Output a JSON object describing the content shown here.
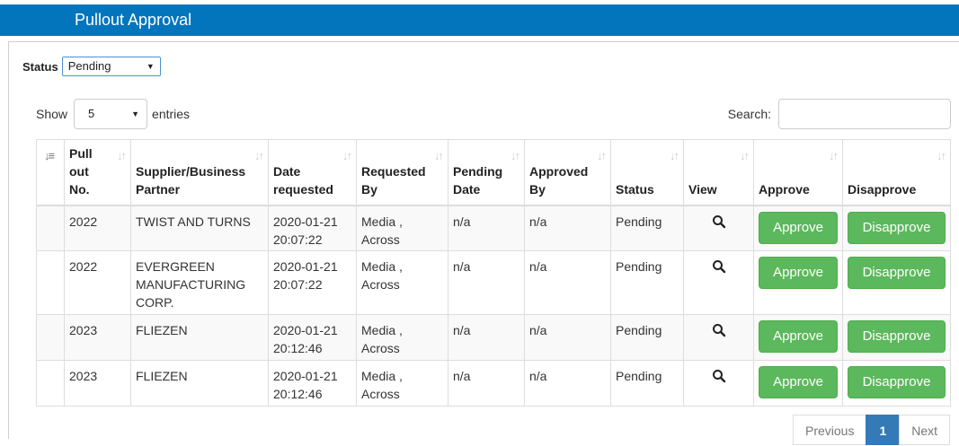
{
  "page": {
    "title": "Pullout Approval"
  },
  "filter": {
    "status_label": "Status",
    "status_value": "Pending"
  },
  "length_control": {
    "show_label": "Show",
    "value": "5",
    "entries_label": "entries"
  },
  "search": {
    "label": "Search:",
    "value": ""
  },
  "table": {
    "columns": [
      "Pull out No.",
      "Supplier/Business Partner",
      "Date requested",
      "Requested By",
      "Pending Date",
      "Approved By",
      "Status",
      "View",
      "Approve",
      "Disapprove"
    ],
    "header_lines": {
      "pullout": [
        "Pull",
        "out",
        "No."
      ],
      "supplier": [
        "Supplier/Business",
        "Partner"
      ],
      "date": [
        "Date",
        "requested"
      ],
      "requested": [
        "Requested",
        "By"
      ],
      "pending": [
        "Pending",
        "Date"
      ],
      "approved": [
        "Approved",
        "By"
      ]
    },
    "rows": [
      {
        "pullout_no": "2022",
        "supplier": [
          "TWIST AND TURNS"
        ],
        "date_requested": [
          "2020-01-21",
          "20:07:22"
        ],
        "requested_by": [
          "Media ,",
          "Across"
        ],
        "pending_date": "n/a",
        "approved_by": "n/a",
        "status": "Pending",
        "approve_label": "Approve",
        "disapprove_label": "Disapprove"
      },
      {
        "pullout_no": "2022",
        "supplier": [
          "EVERGREEN",
          "MANUFACTURING",
          "CORP."
        ],
        "date_requested": [
          "2020-01-21",
          "20:07:22"
        ],
        "requested_by": [
          "Media ,",
          "Across"
        ],
        "pending_date": "n/a",
        "approved_by": "n/a",
        "status": "Pending",
        "approve_label": "Approve",
        "disapprove_label": "Disapprove"
      },
      {
        "pullout_no": "2023",
        "supplier": [
          "FLIEZEN"
        ],
        "date_requested": [
          "2020-01-21",
          "20:12:46"
        ],
        "requested_by": [
          "Media ,",
          "Across"
        ],
        "pending_date": "n/a",
        "approved_by": "n/a",
        "status": "Pending",
        "approve_label": "Approve",
        "disapprove_label": "Disapprove"
      },
      {
        "pullout_no": "2023",
        "supplier": [
          "FLIEZEN"
        ],
        "date_requested": [
          "2020-01-21",
          "20:12:46"
        ],
        "requested_by": [
          "Media ,",
          "Across"
        ],
        "pending_date": "n/a",
        "approved_by": "n/a",
        "status": "Pending",
        "approve_label": "Approve",
        "disapprove_label": "Disapprove"
      }
    ]
  },
  "pagination": {
    "previous_label": "Previous",
    "current_page": "1",
    "next_label": "Next"
  },
  "icons": {
    "view": "search-icon",
    "sort": "sort-arrows-icon",
    "sort_active": "sort-amount-asc-icon"
  },
  "colors": {
    "title_bar": "#0275bd",
    "approve_button": "#5cb85c",
    "active_page": "#337ab7"
  }
}
